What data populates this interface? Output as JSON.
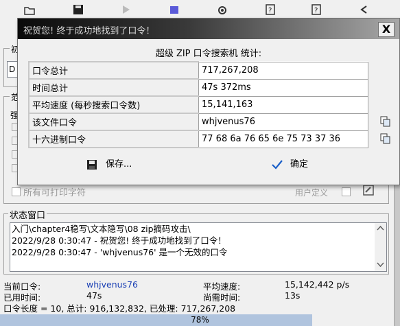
{
  "dialog": {
    "title": "祝贺您! 终于成功地找到了口令！",
    "close_label": "X",
    "heading": "超级 ZIP 口令搜索机 统计:",
    "rows": [
      {
        "label": "口令总计",
        "value": "717,267,208"
      },
      {
        "label": "时间总计",
        "value": "47s 372ms"
      },
      {
        "label": "平均速度 (每秒搜索口令数)",
        "value": "15,141,163"
      },
      {
        "label": "该文件口令",
        "value": "whjvenus76"
      },
      {
        "label": "十六进制口令",
        "value": "77 68 6a 76 65 6e 75 73 37 36"
      }
    ],
    "save_label": "保存...",
    "ok_label": "确定"
  },
  "background": {
    "option_printable": "所有可打印字符",
    "user_defined": "用户定义",
    "left_stub_letters": [
      "初",
      "D",
      "范",
      "强"
    ]
  },
  "status_window": {
    "title": "状态窗口",
    "lines": [
      "入门\\chapter4稳写\\文本隐写\\08 zip摘码攻击\\",
      "2022/9/28 0:30:47 - 祝贺您! 终于成功地找到了口令！",
      "2022/9/28 0:30:47 - 'whjvenus76' 是一个无效的口令"
    ]
  },
  "info": {
    "current_label": "当前口令:",
    "current_value": "whjvenus76",
    "avg_label": "平均速度:",
    "avg_value": "15,142,442 p/s",
    "elapsed_label": "已用时间:",
    "elapsed_value": "47s",
    "remaining_label": "尚需时间:",
    "remaining_value": "13s",
    "summary": "口令长度 = 10, 总计: 916,132,832, 已处理: 717,267,208"
  },
  "progress": {
    "percent_text": "78%",
    "fraction": 0.78
  },
  "colors": {
    "progress_fill": "#b0c4de",
    "value_blue": "#1a3fb4",
    "checkmark_blue": "#1a5fc8"
  }
}
